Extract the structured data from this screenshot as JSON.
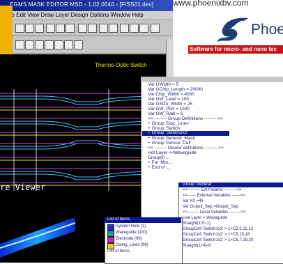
{
  "header": {
    "url": "www.phoenixbv.com"
  },
  "logo": {
    "wordmark": "Phoe",
    "tagline": "Software for micro- and nano tec"
  },
  "window": {
    "title": "EGMS MASK EDITOR MSD - 1.02.0040 - [FISS01.dev]",
    "menu": "File  Edit  View  Draw  Layer  Design  Options  Window  Help"
  },
  "canvas": {
    "title": "Thermo-Optic Switch",
    "viewer_label": "re Viewer"
  },
  "code": {
    "lines": [
      "Var GWidth = 5",
      "Var GChip_Length = 20000",
      "Var Chip_Width = 4000",
      "Var GW_Lead = 100",
      "Var GSize_Width = 25",
      "Var GW_Port = 1500",
      "Var GW_Radi = 6",
      "<<--------- Group Definitions --------->>",
      "+ Group 'Disc_Lines'",
      "+ Group 'Switch'",
      "+ Group 'Switch2x2'",
      "+ Group General_Mask",
      "+ Group 'Device_Cell'",
      "<<--------- Device definitions --------->>",
      "Hot Layer <<Waveguide",
      "Group(0 ...",
      "+ For 'Mor...",
      "+ End of ..."
    ],
    "selected": "+ Group 'Switch2x2'"
  },
  "popup": {
    "selected": "Group 'General'",
    "lines": [
      "<<--------- Ext Params --------->>",
      "<<------ External Variables ------>>",
      "Var X0 =49",
      "Var Output_Sep =Output_Sep",
      "<<-------- Local Variables -------->>",
      "Use Layer = Waveguide",
      "Straight(1:0~1)",
      "GroupCell 'Switch1x2' > 1+C3,5,11,12",
      "GroupCell 'Switch1x2' > 1+C5,15,16",
      "GroupCell 'Switch1x2' > 1+C6,7,18,20",
      "Straight(1+4)-8"
    ]
  },
  "layers": {
    "header": "List of Items",
    "items": [
      {
        "label": "System Hole (1)",
        "color": "#2030c0"
      },
      {
        "label": "Waveguide (100)",
        "color": "#10a0a0"
      },
      {
        "label": "Electrode (90)",
        "color": "#d020c0"
      },
      {
        "label": "Dicing_Lines (98)",
        "color": "#e0d020"
      },
      {
        "label": "List of Items",
        "color": "#ffffff"
      }
    ]
  }
}
